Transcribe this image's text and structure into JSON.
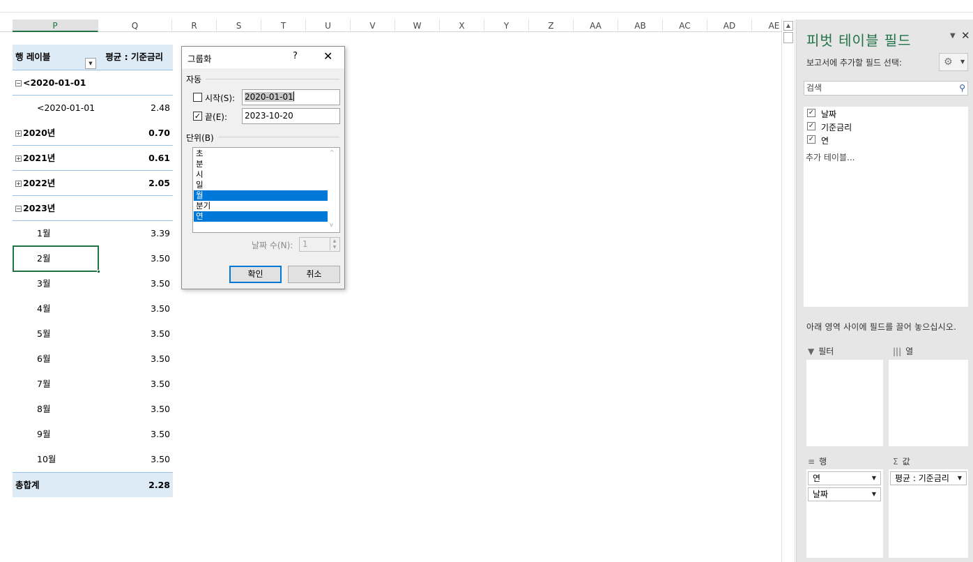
{
  "columns": [
    "P",
    "Q",
    "R",
    "S",
    "T",
    "U",
    "V",
    "W",
    "X",
    "Y",
    "Z",
    "AA",
    "AB",
    "AC",
    "AD",
    "AE"
  ],
  "selected_column": "P",
  "pivot": {
    "header_row_label": "행 레이블",
    "header_value_label": "평균 : 기준금리",
    "rows": [
      {
        "type": "group",
        "expander": "minus",
        "label": "<2020-01-01",
        "value": ""
      },
      {
        "type": "child",
        "label": "<2020-01-01",
        "value": "2.48"
      },
      {
        "type": "group",
        "expander": "plus",
        "label": "2020년",
        "value": "0.70"
      },
      {
        "type": "group",
        "expander": "plus",
        "label": "2021년",
        "value": "0.61"
      },
      {
        "type": "group",
        "expander": "plus",
        "label": "2022년",
        "value": "2.05"
      },
      {
        "type": "group",
        "expander": "minus",
        "label": "2023년",
        "value": ""
      },
      {
        "type": "child",
        "label": "1월",
        "value": "3.39"
      },
      {
        "type": "child",
        "label": "2월",
        "value": "3.50"
      },
      {
        "type": "child",
        "label": "3월",
        "value": "3.50"
      },
      {
        "type": "child",
        "label": "4월",
        "value": "3.50"
      },
      {
        "type": "child",
        "label": "5월",
        "value": "3.50"
      },
      {
        "type": "child",
        "label": "6월",
        "value": "3.50"
      },
      {
        "type": "child",
        "label": "7월",
        "value": "3.50"
      },
      {
        "type": "child",
        "label": "8월",
        "value": "3.50"
      },
      {
        "type": "child",
        "label": "9월",
        "value": "3.50"
      },
      {
        "type": "child",
        "label": "10월",
        "value": "3.50"
      }
    ],
    "total_label": "총합계",
    "total_value": "2.28"
  },
  "dialog": {
    "title": "그룹화",
    "help": "?",
    "close": "✕",
    "auto_section": "자동",
    "start_label": "시작(S):",
    "start_checked": false,
    "start_value": "2020-01-01",
    "end_label": "끝(E):",
    "end_checked": true,
    "end_value": "2023-10-20",
    "unit_section": "단위(B)",
    "units": [
      {
        "label": "초",
        "selected": false
      },
      {
        "label": "분",
        "selected": false
      },
      {
        "label": "시",
        "selected": false
      },
      {
        "label": "일",
        "selected": false
      },
      {
        "label": "월",
        "selected": true
      },
      {
        "label": "분기",
        "selected": false
      },
      {
        "label": "연",
        "selected": true
      }
    ],
    "days_label": "날짜 수(N):",
    "days_value": "1",
    "ok_label": "확인",
    "cancel_label": "취소"
  },
  "pane": {
    "title": "피벗 테이블 필드",
    "subtitle": "보고서에 추가할 필드 선택:",
    "search_placeholder": "검색",
    "fields": [
      {
        "label": "날짜",
        "checked": true
      },
      {
        "label": "기준금리",
        "checked": true
      },
      {
        "label": "연",
        "checked": true
      }
    ],
    "more_tables": "추가 테이블...",
    "drag_hint": "아래 영역 사이에 필드를 끌어 놓으십시오.",
    "areas": {
      "filter_label": "필터",
      "columns_label": "열",
      "rows_label": "행",
      "values_label": "값",
      "rows_items": [
        "연",
        "날짜"
      ],
      "values_items": [
        "평균 : 기준금리"
      ]
    }
  },
  "accent_color": "#217346",
  "selection_color": "#0078d7"
}
